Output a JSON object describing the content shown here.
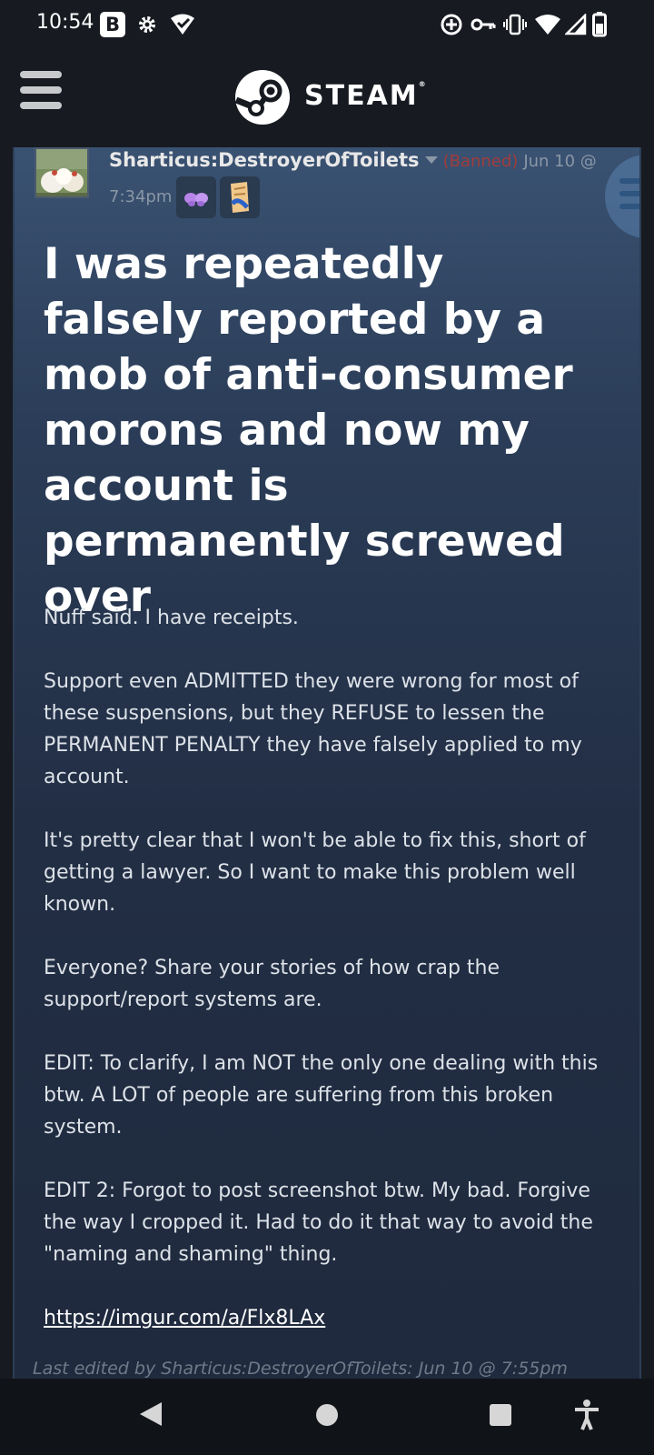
{
  "status_bar": {
    "time": "10:54",
    "left_icons": [
      "b-app-icon",
      "gear-icon",
      "wifi-check-icon"
    ],
    "right_icons": [
      "add-circle-icon",
      "key-icon",
      "vibrate-icon",
      "wifi-icon",
      "signal-icon",
      "battery-icon"
    ]
  },
  "header": {
    "menu_icon": "hamburger-menu-icon",
    "brand": "STEAM"
  },
  "post": {
    "author": "Sharticus:DestroyerOfToilets",
    "status": "(Banned)",
    "date": "Jun 10 @",
    "time": "7:34pm",
    "title": "I was repeatedly falsely reported by a mob of anti-consumer morons and now my account is permanently screwed over",
    "paragraphs": [
      "Nuff said. I have receipts.",
      "Support even ADMITTED they were wrong for most of these suspensions, but they REFUSE to lessen the PERMANENT PENALTY they have falsely applied to my account.",
      "It's pretty clear that I won't be able to fix this, short of getting a lawyer. So I want to make this problem well known.",
      "Everyone? Share your stories of how crap the support/report systems are.",
      "EDIT: To clarify, I am NOT the only one dealing with this btw. A LOT of people are suffering from this broken system.",
      "EDIT 2: Forgot to post screenshot btw. My bad. Forgive the way I cropped it. Had to do it that way to avoid the \"naming and shaming\" thing."
    ],
    "link": "https://imgur.com/a/Flx8LAx",
    "last_edited": "Last edited by Sharticus:DestroyerOfToilets: Jun 10 @ 7:55pm"
  },
  "colors": {
    "background": "#171a21",
    "banned": "#a13c3c",
    "muted": "#8a97a6"
  },
  "nav_bar": {
    "icons": [
      "back-icon",
      "home-icon",
      "recents-icon",
      "accessibility-icon"
    ]
  }
}
